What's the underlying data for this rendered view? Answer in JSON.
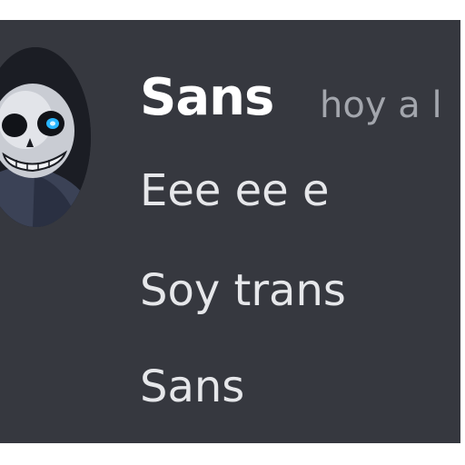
{
  "message_group": {
    "avatar": {
      "icon": "skeleton-avatar-icon",
      "eye_glow_color": "#29b6ff"
    },
    "author": {
      "username": "Sans",
      "timestamp": "hoy a l"
    },
    "messages": [
      {
        "text": "Eee ee e"
      },
      {
        "text": "Soy trans"
      },
      {
        "text": "Sans"
      }
    ]
  },
  "colors": {
    "background": "#36383f",
    "username": "#ffffff",
    "timestamp": "#a3a6ad",
    "message_text": "#e6e7ea"
  }
}
